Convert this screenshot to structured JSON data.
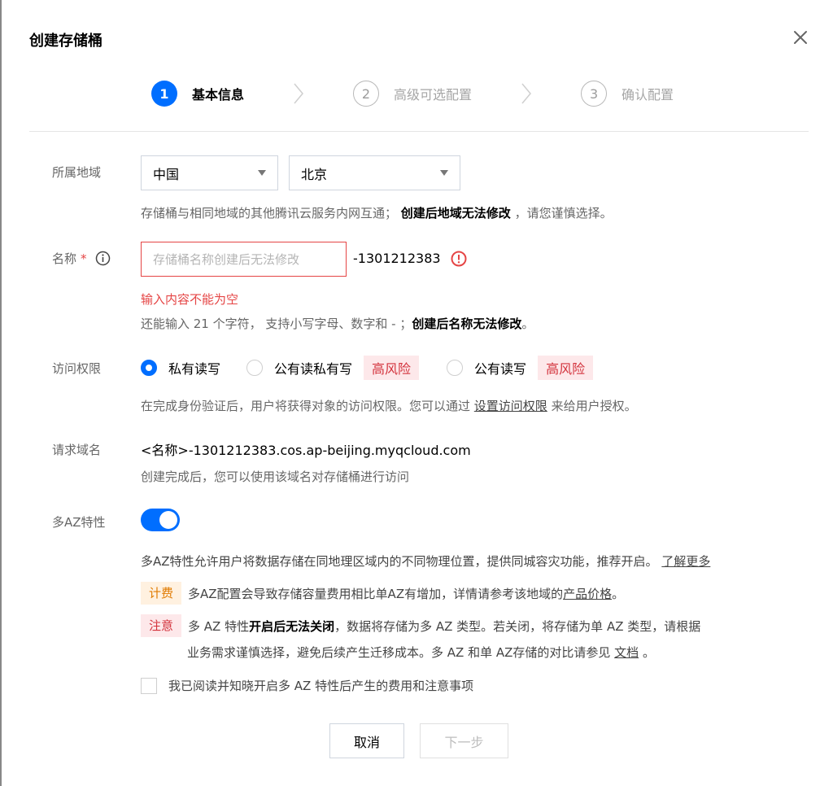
{
  "dialog": {
    "title": "创建存储桶"
  },
  "steps": [
    {
      "number": "1",
      "label": "基本信息"
    },
    {
      "number": "2",
      "label": "高级可选配置"
    },
    {
      "number": "3",
      "label": "确认配置"
    }
  ],
  "region": {
    "label": "所属地域",
    "country": "中国",
    "city": "北京",
    "hint_prefix": "存储桶与相同地域的其他腾讯云服务内网互通；",
    "hint_bold": "创建后地域无法修改",
    "hint_suffix": "，请您谨慎选择。"
  },
  "name": {
    "label": "名称",
    "required_mark": "*",
    "placeholder": "存储桶名称创建后无法修改",
    "value": "",
    "suffix": "-1301212383",
    "error": "输入内容不能为空",
    "hint_prefix": "还能输入 21 个字符， 支持小写字母、数字和 - ；",
    "hint_bold": "创建后名称无法修改",
    "hint_suffix": "。"
  },
  "access": {
    "label": "访问权限",
    "options": [
      {
        "label": "私有读写",
        "checked": true
      },
      {
        "label": "公有读私有写",
        "badge": "高风险"
      },
      {
        "label": "公有读写",
        "badge": "高风险"
      }
    ],
    "hint_prefix": "在完成身份验证后，用户将获得对象的访问权限。您可以通过 ",
    "hint_link": "设置访问权限",
    "hint_suffix": " 来给用户授权。"
  },
  "domain": {
    "label": "请求域名",
    "value": "<名称>-1301212383.cos.ap-beijing.myqcloud.com",
    "hint": "创建完成后，您可以使用该域名对存储桶进行访问"
  },
  "multi_az": {
    "label": "多AZ特性",
    "enabled": true,
    "desc": "多AZ特性允许用户将数据存储在同地理区域内的不同物理位置，提供同城容灾功能，推荐开启。",
    "desc_link": "了解更多",
    "fee_tag": "计费",
    "fee_text": "多AZ配置会导致存储容量费用相比单AZ有增加，详情请参考该地域的 ",
    "fee_link": "产品价格",
    "fee_suffix": " 。",
    "note_tag": "注意",
    "note_prefix": "多 AZ 特性 ",
    "note_bold": "开启后无法关闭",
    "note_suffix": "，数据将存储为多 AZ 类型。若关闭，将存储为单 AZ 类型，请根据",
    "note_line2": "业务需求谨慎选择，避免后续产生迁移成本。多 AZ 和单 AZ存储的对比请参见 ",
    "note_link": "文档",
    "note_line2_suffix": " 。",
    "checkbox_label": "我已阅读并知晓开启多 AZ 特性后产生的费用和注意事项"
  },
  "buttons": {
    "cancel": "取消",
    "next": "下一步"
  },
  "colors": {
    "primary": "#006eff",
    "error": "#e54545",
    "risk_bg": "#fde8ea",
    "risk_text": "#d3323c",
    "fee_bg": "#fff1e0",
    "fee_text": "#e07a00"
  }
}
